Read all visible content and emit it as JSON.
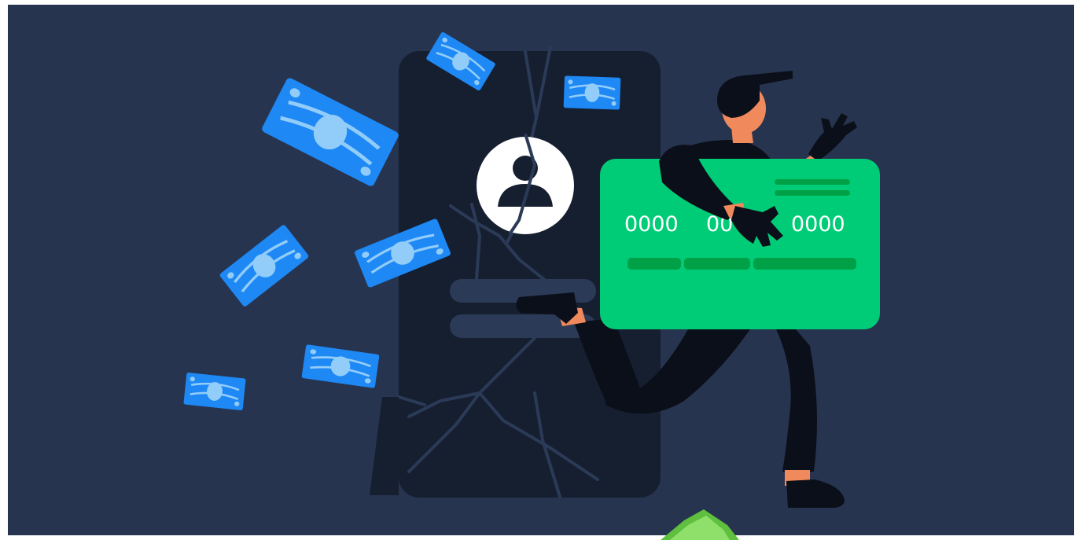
{
  "colors": {
    "background": "#26344f",
    "phone": "#161f30",
    "crack": "#2b3a57",
    "bill_dark": "#1e88f5",
    "bill_light": "#92cdf9",
    "card": "#00cc78",
    "card_bar": "#00a146",
    "skin": "#f08a5d",
    "outfit": "#0b0f19"
  },
  "icons": {
    "profile": "user-icon",
    "bills": "banknote-icon",
    "card": "credit-card-icon"
  },
  "card": {
    "number_group_1": "0000",
    "number_group_2": "00",
    "number_group_3": "0000"
  }
}
